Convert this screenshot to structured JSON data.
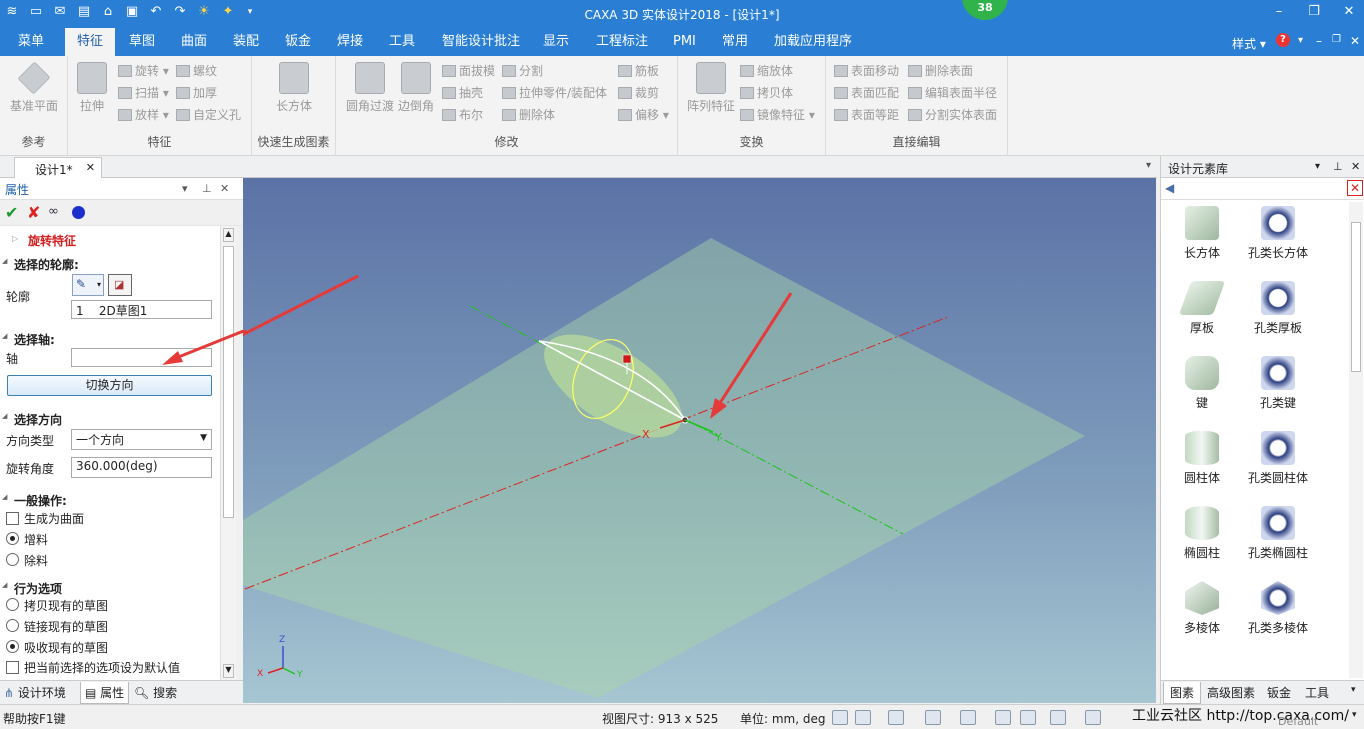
{
  "app": {
    "title": "CAXA 3D 实体设计2018 - [设计1*]",
    "notif_count": "38"
  },
  "menu": {
    "tabs": [
      "菜单",
      "特征",
      "草图",
      "曲面",
      "装配",
      "钣金",
      "焊接",
      "工具",
      "智能设计批注",
      "显示",
      "工程标注",
      "PMI",
      "常用",
      "加载应用程序"
    ],
    "active": "特征",
    "style_label": "样式"
  },
  "ribbon": {
    "groups": {
      "ref": "参考",
      "feature": "特征",
      "quick": "快速生成图素",
      "modify": "修改",
      "transform": "变换",
      "direct": "直接编辑"
    },
    "ref_big": "基准平面",
    "feat_big": "拉伸",
    "feat_small": [
      "旋转",
      "扫描",
      "放样",
      "螺纹",
      "加厚",
      "自定义孔"
    ],
    "quick_big": "长方体",
    "mod_big": [
      "圆角过渡",
      "边倒角"
    ],
    "mod_small": [
      "面拔模",
      "抽壳",
      "布尔",
      "分割",
      "拉伸零件/装配体",
      "删除体",
      "筋板",
      "裁剪",
      "偏移"
    ],
    "trans_big": "阵列特征",
    "trans_small": [
      "缩放体",
      "拷贝体",
      "镜像特征"
    ],
    "direct_small": [
      "表面移动",
      "表面匹配",
      "表面等距",
      "删除表面",
      "编辑表面半径",
      "分割实体表面"
    ]
  },
  "doc_tab": "设计1*",
  "props": {
    "header": "属性",
    "feature_name": "旋转特征",
    "sec_profile": "选择的轮廓:",
    "profile_label": "轮廓",
    "profile_item_num": "1",
    "profile_item": "2D草图1",
    "sec_axis": "选择轴:",
    "axis_label": "轴",
    "switch_dir": "切换方向",
    "sec_dir": "选择方向",
    "dir_type_label": "方向类型",
    "dir_type_value": "一个方向",
    "angle_label": "旋转角度",
    "angle_value": "360.000(deg)",
    "sec_general": "一般操作:",
    "opt_surface": "生成为曲面",
    "opt_add": "增料",
    "opt_remove": "除料",
    "sec_behavior": "行为选项",
    "opt_copy": "拷贝现有的草图",
    "opt_link": "链接现有的草图",
    "opt_absorb": "吸收现有的草图",
    "opt_default": "把当前选择的选项设为默认值"
  },
  "bottom_tabs": [
    "设计环境",
    "属性",
    "搜索"
  ],
  "viewport": {
    "axis_x": "X",
    "axis_y": "Y",
    "axis_z": "Z"
  },
  "library": {
    "header": "设计元素库",
    "items": [
      "长方体",
      "孔类长方体",
      "厚板",
      "孔类厚板",
      "键",
      "孔类键",
      "圆柱体",
      "孔类圆柱体",
      "椭圆柱",
      "孔类椭圆柱",
      "多棱体",
      "孔类多棱体"
    ],
    "tabs": [
      "图素",
      "高级图素",
      "钣金",
      "工具"
    ]
  },
  "status": {
    "help": "帮助按F1键",
    "view_size": "视图尺寸: 913 x 525",
    "units": "单位: mm, deg",
    "watermark": "工业云社区 http://top.caxa.com/",
    "default": "Default"
  }
}
